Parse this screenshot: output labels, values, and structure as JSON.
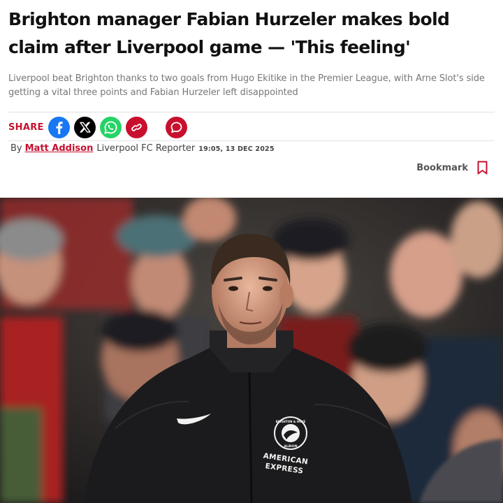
{
  "article": {
    "headline": "Brighton manager Fabian Hurzeler makes bold claim after Liverpool game — 'This feeling'",
    "standfirst": "Liverpool beat Brighton thanks to two goals from Hugo Ekitike in the Premier League, with Arne Slot's side getting a vital three points and Fabian Hurzeler left disappointed"
  },
  "share": {
    "label": "SHARE",
    "buttons": [
      {
        "name": "facebook",
        "icon": "facebook-icon",
        "color": "#1877f2"
      },
      {
        "name": "x",
        "icon": "x-icon",
        "color": "#000000"
      },
      {
        "name": "whatsapp",
        "icon": "whatsapp-icon",
        "color": "#25d366"
      },
      {
        "name": "copy-link",
        "icon": "link-icon",
        "color": "#c8102e"
      },
      {
        "name": "comments",
        "icon": "comment-icon",
        "color": "#c8102e"
      }
    ]
  },
  "byline": {
    "prefix": "By",
    "author": "Matt Addison",
    "role": "Liverpool FC Reporter",
    "date": "19:05, 13 DEC 2025"
  },
  "bookmark": {
    "label": "Bookmark",
    "icon": "bookmark-icon",
    "color": "#c8102e"
  },
  "hero_image": {
    "shirt_badge_top": "BRIGHTON & HOVE",
    "shirt_badge_bottom": "ALBION",
    "sponsor_line1": "AMERICAN",
    "sponsor_line2": "EXPRESS"
  },
  "theme": {
    "accent": "#c8102e",
    "muted_text": "#777777"
  }
}
